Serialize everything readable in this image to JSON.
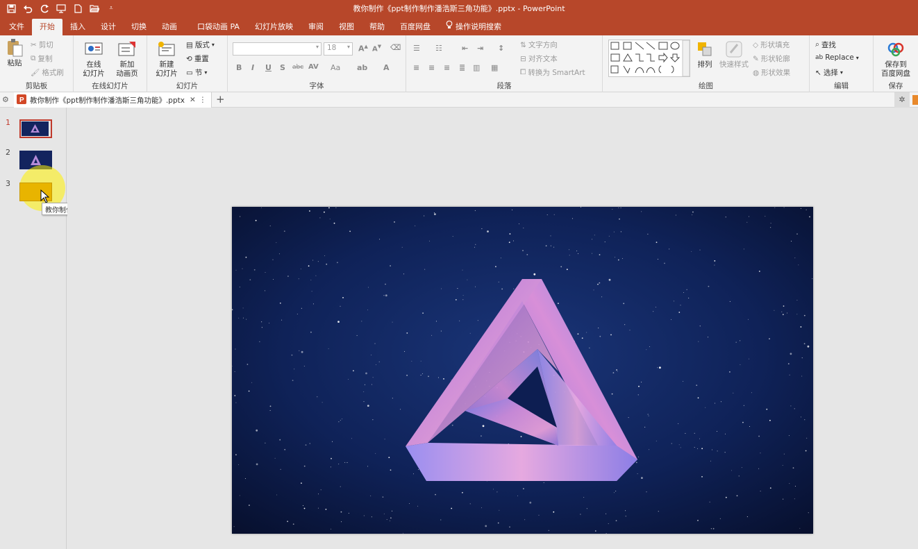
{
  "window": {
    "title": "教你制作《ppt制作制作潘浩斯三角功能》.pptx  -  PowerPoint"
  },
  "qat": {
    "icons": [
      "save-icon",
      "undo-icon",
      "redo-icon",
      "present-icon",
      "new-icon",
      "open-icon",
      "customize-icon"
    ]
  },
  "ribbon_tabs": [
    "文件",
    "开始",
    "插入",
    "设计",
    "切换",
    "动画",
    "口袋动画 PA",
    "幻灯片放映",
    "审阅",
    "视图",
    "帮助",
    "百度网盘"
  ],
  "active_tab": "开始",
  "tell_me": "操作说明搜索",
  "clipboard": {
    "paste": "粘贴",
    "cut": "剪切",
    "copy": "复制",
    "format_painter": "格式刷",
    "label": "剪贴板"
  },
  "online_slides": {
    "online": "在线\n幻灯片",
    "new_anim": "新加\n动画页",
    "label": "在线幻灯片"
  },
  "slides_group": {
    "new_slide": "新建\n幻灯片",
    "layout": "版式",
    "reset": "重置",
    "section": "节",
    "label": "幻灯片"
  },
  "font": {
    "font_name": "",
    "font_size": "18",
    "label": "字体",
    "buttons": [
      "B",
      "I",
      "U",
      "S",
      "abc",
      "AV",
      "Aa",
      "A"
    ]
  },
  "paragraph": {
    "text_direction": "文字方向",
    "align_text": "对齐文本",
    "smartart": "转换为 SmartArt",
    "label": "段落"
  },
  "drawing": {
    "arrange": "排列",
    "quick_styles": "快速样式",
    "shape_fill": "形状填充",
    "shape_outline": "形状轮廓",
    "shape_effects": "形状效果",
    "label": "绘图"
  },
  "editing": {
    "find": "查找",
    "replace": "Replace",
    "select": "选择",
    "label": "编辑"
  },
  "save_group": {
    "save_baidu": "保存到\n百度网盘",
    "label": "保存"
  },
  "doc_tab": {
    "name": "教你制作《ppt制作制作潘浩斯三角功能》.pptx"
  },
  "slides": [
    {
      "num": "1"
    },
    {
      "num": "2"
    },
    {
      "num": "3"
    }
  ],
  "tooltip": "教你制作《制作潘浩斯三角》",
  "colors": {
    "accent": "#b7472a",
    "ribbon_bg": "#f3f3f3",
    "slide_bg": "#0c1a46",
    "thumb3": "#e8b400"
  }
}
